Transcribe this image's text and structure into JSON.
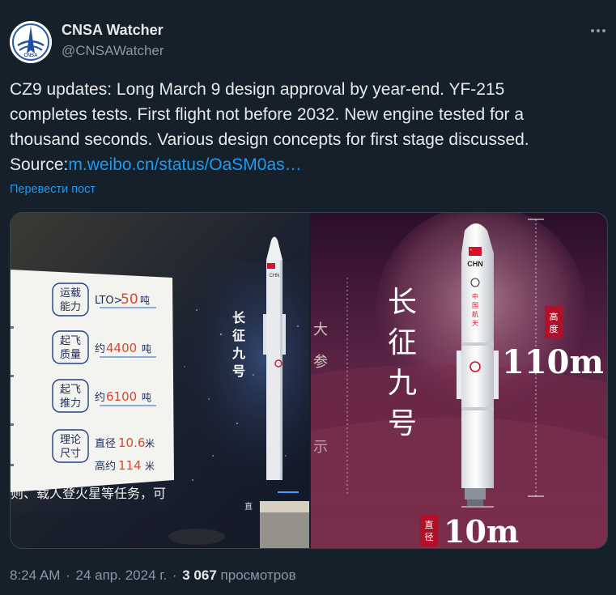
{
  "author": {
    "name": "CNSA Watcher",
    "handle": "@CNSAWatcher",
    "avatar_label": "CNSA"
  },
  "more_icon": "more-horizontal-icon",
  "tweet": {
    "lines": [
      "CZ9 updates: Long March 9 design approval by year-end. YF-215",
      "completes tests. First flight not before 2032. New engine tested for a",
      "thousand seconds. Various design concepts for first stage discussed."
    ],
    "source_label": "Source:",
    "source_link": "m.weibo.cn/status/OaSM0as…",
    "translate_label": "Перевести пост"
  },
  "left_photo": {
    "rows": [
      {
        "label": [
          "运载",
          "能力"
        ],
        "value_prefix": "LTO>",
        "value_num": "50",
        "value_unit": "吨"
      },
      {
        "label": [
          "起飞",
          "质量"
        ],
        "value_prefix": "约",
        "value_num": "4400",
        "value_unit": "吨"
      },
      {
        "label": [
          "起飞",
          "推力"
        ],
        "value_prefix": "约",
        "value_num": "6100",
        "value_unit": "吨"
      },
      {
        "label": [
          "理论",
          "尺寸"
        ],
        "value_prefix": "直径",
        "value_num": "10.6",
        "value_unit": "米",
        "value2_prefix": "高约",
        "value2_num": "114",
        "value2_unit": "米"
      }
    ],
    "bottom_text": "则、载人登火星等任务，可",
    "vertical_name": [
      "长",
      "征",
      "九",
      "号"
    ],
    "rocket_flag_text": "CHN",
    "small_char": "直"
  },
  "right_photo": {
    "vertical_name": [
      "长",
      "征",
      "九",
      "号"
    ],
    "rocket_flag_text": "CHN",
    "rocket_vertical_text": [
      "中",
      "国",
      "航",
      "天"
    ],
    "height_tag": [
      "高",
      "度"
    ],
    "height_value": "110m",
    "diameter_tag": [
      "直",
      "径"
    ],
    "diameter_value": "10m"
  },
  "footer": {
    "time": "8:24 AM",
    "separator": "·",
    "date": "24 апр. 2024 г.",
    "views_count": "3 067",
    "views_label": "просмотров"
  },
  "colors": {
    "background": "#15202b",
    "text": "#e7e9ea",
    "secondary": "#8b98a5",
    "link": "#1d9bf0",
    "accent_red": "#c8102e"
  }
}
